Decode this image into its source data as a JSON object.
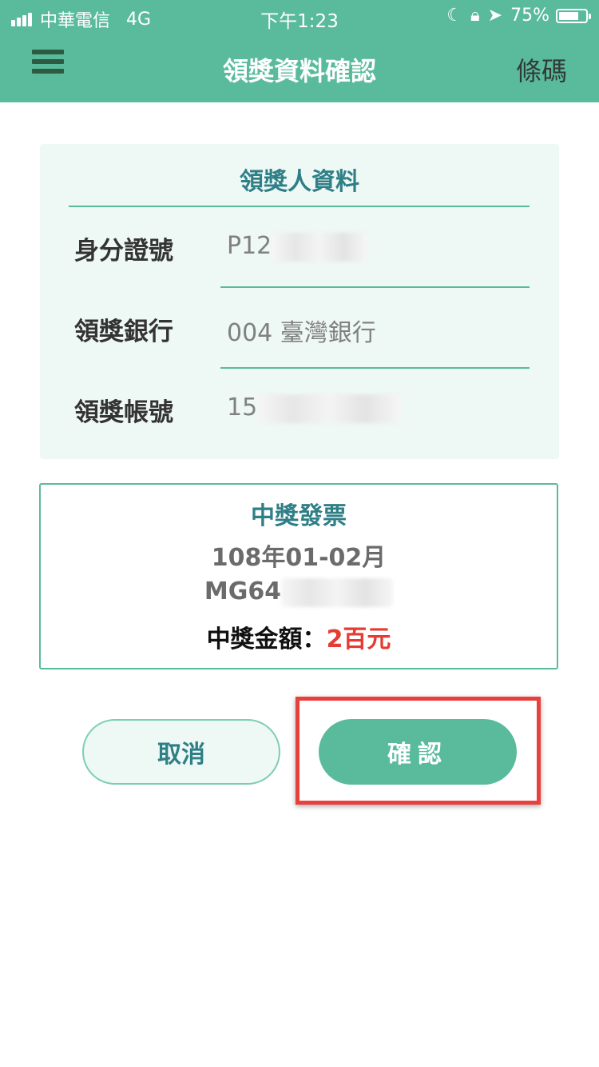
{
  "status_bar": {
    "carrier": "中華電信",
    "network": "4G",
    "time": "下午1:23",
    "battery_text": "75%",
    "battery_level": 0.75
  },
  "nav": {
    "title": "領獎資料確認",
    "right_label": "條碼",
    "menu_icon": "hamburger-menu-icon"
  },
  "winner_info": {
    "title": "領獎人資料",
    "rows": [
      {
        "label": "身分證號",
        "value": "P12"
      },
      {
        "label": "領獎銀行",
        "value": "004 臺灣銀行"
      },
      {
        "label": "領獎帳號",
        "value": "15"
      }
    ]
  },
  "invoice": {
    "title": "中獎發票",
    "period": "108年01-02月",
    "number": "MG64",
    "prize_label": "中獎金額：",
    "prize_amount": "2百元"
  },
  "buttons": {
    "cancel": "取消",
    "confirm": "確認"
  },
  "colors": {
    "brand_green": "#5abb9c",
    "title_teal": "#2f7f86",
    "prize_red": "#e53b32",
    "highlight_red": "#e8403c"
  }
}
